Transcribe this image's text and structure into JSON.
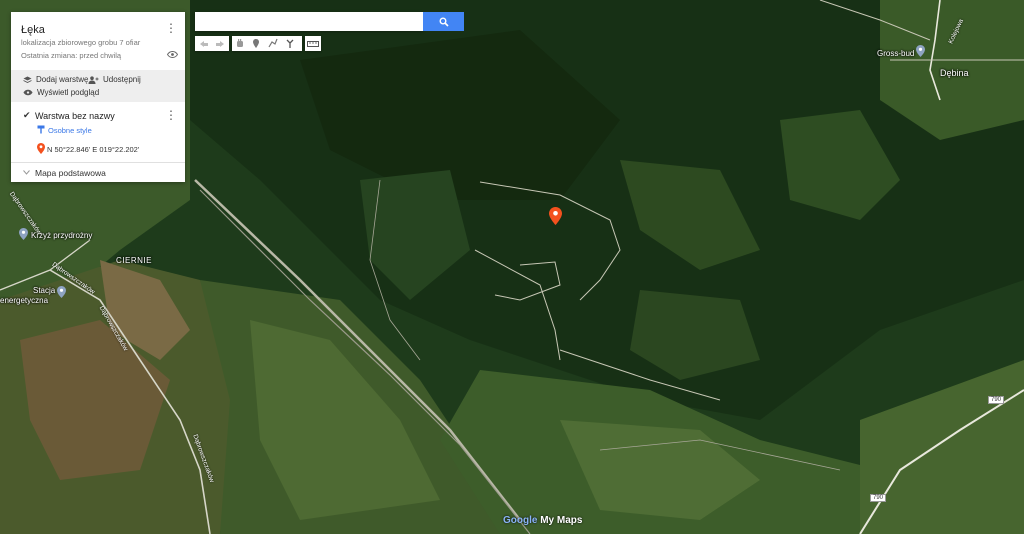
{
  "panel": {
    "title": "Łęka",
    "description": "lokalizacja zbiorowego grobu 7 ofiar",
    "last_change": "Ostatnia zmiana: przed chwilą",
    "add_layer": "Dodaj warstwę",
    "share": "Udostępnij",
    "preview": "Wyświetl podgląd",
    "layer_name": "Warstwa bez nazwy",
    "custom_styles": "Osobne style",
    "marker_coords": "N 50°22.846' E 019°22.202'",
    "base_map": "Mapa podstawowa"
  },
  "search": {
    "placeholder": "",
    "value": ""
  },
  "map_labels": {
    "krzyz": "Krzyż przydrożny",
    "ciernie": "CIERNIE",
    "stacja_line1": "Stacja",
    "stacja_line2": "energetyczna",
    "gross_bud": "Gross-bud",
    "debina": "Dębina",
    "dabrowszczakow_1": "Dąbrowszczaków",
    "dabrowszczakow_2": "Dąbrowszczaków",
    "dabrowszczakow_3": "Dąbrowszczaków",
    "dabrowszczakow_4": "Dąbrowszczaków",
    "kolejowa": "Kolejowa",
    "route_790_a": "790",
    "route_790_b": "790"
  },
  "logo": {
    "google": "Google",
    "mymaps": " My Maps"
  },
  "colors": {
    "accent": "#4285f4",
    "marker": "#f4511e",
    "link": "#3b78e7"
  }
}
